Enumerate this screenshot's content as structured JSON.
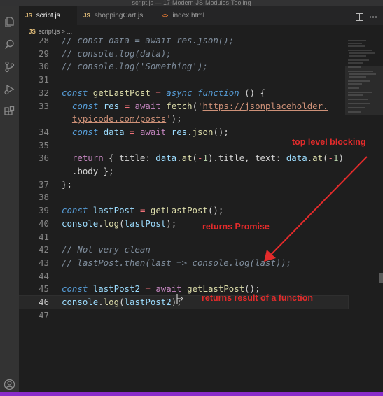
{
  "window": {
    "title": "script.js — 17-Modern-JS-Modules-Tooling"
  },
  "tabs": [
    {
      "icon_text": "JS",
      "label": "script.js",
      "active": true,
      "close": "×"
    },
    {
      "icon_text": "JS",
      "label": "shoppingCart.js",
      "active": false
    },
    {
      "icon_text": "<>",
      "label": "index.html",
      "active": false
    }
  ],
  "breadcrumb": {
    "icon_text": "JS",
    "file": "script.js",
    "chevron": ">",
    "more": "..."
  },
  "editor": {
    "lines": [
      {
        "n": "28",
        "html": "<span class=\"cm\">// const data = await res.json();</span>"
      },
      {
        "n": "29",
        "html": "<span class=\"cm\">// console.log(data);</span>"
      },
      {
        "n": "30",
        "html": "<span class=\"cm\">// console.log('Something');</span>"
      },
      {
        "n": "31",
        "html": ""
      },
      {
        "n": "32",
        "html": "<span class=\"k\">const</span> <span class=\"f\">getLastPost</span> <span class=\"op\">=</span> <span class=\"k\">async</span> <span class=\"k\">function</span> () {"
      },
      {
        "n": "33",
        "html": "  <span class=\"k\">const</span> <span class=\"v\">res</span> <span class=\"op\">=</span> <span class=\"kr\">await</span> <span class=\"f\">fetch</span>(<span class=\"s\">'</span><span class=\"u\">https://jsonplaceholder.</span>"
      },
      {
        "n": "",
        "html": "  <span class=\"u\">typicode.com/posts</span><span class=\"s\">'</span>);"
      },
      {
        "n": "34",
        "html": "  <span class=\"k\">const</span> <span class=\"v\">data</span> <span class=\"op\">=</span> <span class=\"kr\">await</span> <span class=\"v\">res</span>.<span class=\"f\">json</span>();"
      },
      {
        "n": "35",
        "html": ""
      },
      {
        "n": "36",
        "html": "  <span class=\"kr\">return</span> { title: <span class=\"v\">data</span>.<span class=\"f\">at</span>(<span class=\"op\">-</span><span class=\"n\">1</span>).title, text: <span class=\"v\">data</span>.<span class=\"f\">at</span>(<span class=\"op\">-</span><span class=\"n\">1</span>)"
      },
      {
        "n": "",
        "html": "  .body };"
      },
      {
        "n": "37",
        "html": "};"
      },
      {
        "n": "38",
        "html": ""
      },
      {
        "n": "39",
        "html": "<span class=\"k\">const</span> <span class=\"v\">lastPost</span> <span class=\"op\">=</span> <span class=\"f\">getLastPost</span>();"
      },
      {
        "n": "40",
        "html": "<span class=\"v\">console</span>.<span class=\"f\">log</span>(<span class=\"v\">lastPost</span>);"
      },
      {
        "n": "41",
        "html": ""
      },
      {
        "n": "42",
        "html": "<span class=\"cm\">// Not very clean</span>"
      },
      {
        "n": "43",
        "html": "<span class=\"cm\">// lastPost.then(last =&gt; console.log(last));</span>"
      },
      {
        "n": "44",
        "html": ""
      },
      {
        "n": "45",
        "html": "<span class=\"k\">const</span> <span class=\"v\">lastPost2</span> <span class=\"op\">=</span> <span class=\"kr\">await</span> <span class=\"f\">getLastPost</span>();"
      },
      {
        "n": "46",
        "html": "<span class=\"v\">console</span>.<span class=\"f\">log</span>(<span class=\"v\">lastPost2</span>);",
        "current": true
      },
      {
        "n": "47",
        "html": ""
      }
    ]
  },
  "annotations": {
    "top_level_blocking": "top level blocking",
    "returns_promise": "returns Promise",
    "returns_result": "returns result of a function"
  },
  "colors": {
    "annotation": "#e32b2b",
    "statusbar": "#8a2cc9",
    "editor_bg": "#1e1e1e"
  }
}
